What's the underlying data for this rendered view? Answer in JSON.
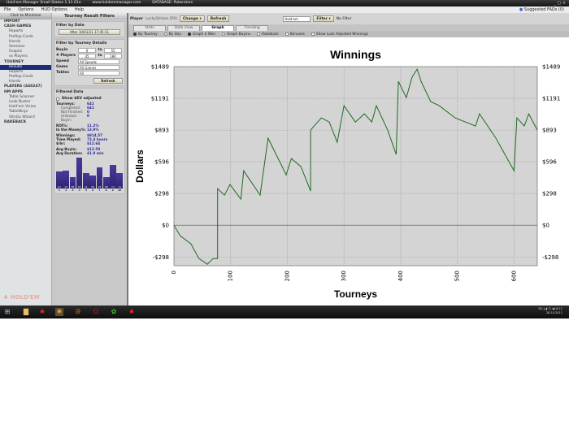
{
  "window": {
    "title": "Hold'em Manager Small Stakes 1.11.01e",
    "site": "www.holdemmanager.com",
    "database": "DATABASE: Pokerstars",
    "controls": [
      "_",
      "□",
      "×"
    ]
  },
  "menu": [
    "File",
    "Options",
    "HUD Options",
    "Help"
  ],
  "faq": "Suggested FAQs (0)",
  "nav": {
    "minimize": "Click to Minimize",
    "items": [
      {
        "label": "IMPORT",
        "type": "sec"
      },
      {
        "label": "CASH GAMES",
        "type": "sec"
      },
      {
        "label": "Reports"
      },
      {
        "label": "Preflop Cards"
      },
      {
        "label": "Hands"
      },
      {
        "label": "Sessions"
      },
      {
        "label": "Graphs"
      },
      {
        "label": "vs Players"
      },
      {
        "label": "TOURNEY",
        "type": "sec"
      },
      {
        "label": "Results",
        "type": "sel"
      },
      {
        "label": "Reports"
      },
      {
        "label": "Preflop Cards"
      },
      {
        "label": "Hands"
      },
      {
        "label": "PLAYERS (448247)",
        "type": "sec"
      },
      {
        "label": "HM APPS",
        "type": "sec"
      },
      {
        "label": "Table Scanner"
      },
      {
        "label": "Leak Buster"
      },
      {
        "label": "Hold'em Vision"
      },
      {
        "label": "TableNinja"
      },
      {
        "label": "SitnGo Wizard"
      },
      {
        "label": "RAKEBACK",
        "type": "sec"
      }
    ],
    "logo": "HOLD'EM MANAGER"
  },
  "filters": {
    "title": "Tourney Result Filters",
    "by_date": "Filter by Date",
    "date_btn": "After 10/01/11 17:45:11",
    "by_details": "Filter by Tourney Details",
    "buyin": {
      "label": "Buyin",
      "from": "0",
      "to_label": "to",
      "to": "55"
    },
    "players": {
      "label": "# Players",
      "from": "45",
      "to_label": "to",
      "to": "180"
    },
    "speed": {
      "label": "Speed",
      "value": "All Speeds"
    },
    "game": {
      "label": "Game",
      "value": "All Games"
    },
    "tables": {
      "label": "Tables",
      "value": "All"
    },
    "refresh": "Refresh",
    "filtered": "Filtered Data",
    "show_ev": "Show $EV adjusted",
    "stats": [
      [
        "Tourneys:",
        "641",
        ""
      ],
      [
        "Completed:",
        "641",
        "sub"
      ],
      [
        "Not Finished:",
        "0",
        "sub"
      ],
      [
        "Unknown Buyin:",
        "0",
        "sub"
      ],
      [
        "",
        "",
        ""
      ],
      [
        "ROI%:",
        "11.2%",
        ""
      ],
      [
        "In the Money%:",
        "13.9%",
        ""
      ],
      [
        "",
        "",
        ""
      ],
      [
        "Winnings:",
        "$914.57",
        ""
      ],
      [
        "Time Played:",
        "72.4 hours",
        ""
      ],
      [
        "$/hr:",
        "$12.64",
        ""
      ],
      [
        "",
        "",
        ""
      ],
      [
        "Avg Buyin:",
        "$12.50",
        ""
      ],
      [
        "Avg Duration:",
        "41.9 min",
        ""
      ]
    ],
    "finish_bars": {
      "labels": [
        "1",
        "2",
        "3",
        "4",
        "5",
        "6",
        "7",
        "8",
        "9",
        "10"
      ],
      "values": [
        "12",
        "13",
        "08",
        "22",
        "11",
        "09",
        "15",
        "08",
        "17",
        "11"
      ]
    }
  },
  "topbar": {
    "player_label": "Player",
    "player": "LuckyStrikes (PX)",
    "change": "Change",
    "refresh": "Refresh",
    "game": "Hold'em",
    "filter": "Filter",
    "no_filter": "No Filter"
  },
  "tabs": [
    {
      "label": "Stats"
    },
    {
      "label": "Data View"
    },
    {
      "label": "Graph",
      "active": true
    },
    {
      "label": "Trending"
    }
  ],
  "options": [
    {
      "label": "By Tourney",
      "kind": "radio",
      "on": true
    },
    {
      "label": "By Day",
      "kind": "radio",
      "on": false
    },
    {
      "label": "Graph $ Won",
      "kind": "radio",
      "on": true
    },
    {
      "label": "Graph Buyins",
      "kind": "radio",
      "on": false
    },
    {
      "label": "Rakeback",
      "kind": "check",
      "on": false
    },
    {
      "label": "Bonuses",
      "kind": "check",
      "on": false
    },
    {
      "label": "Show Luck Adjusted Winnings",
      "kind": "check",
      "on": true
    }
  ],
  "chart_data": {
    "type": "line",
    "title": "Winnings",
    "xlabel": "Tourneys",
    "ylabel": "Dollars",
    "xlim": [
      0,
      641
    ],
    "ylim": [
      -380,
      1489
    ],
    "yticks": [
      "$1489",
      "$1191",
      "$893",
      "$596",
      "$298",
      "$0",
      "-$298"
    ],
    "ytick_values": [
      1489,
      1191,
      893,
      596,
      298,
      0,
      -298
    ],
    "xticks": [
      "0",
      "100",
      "200",
      "300",
      "400",
      "500",
      "600"
    ],
    "grid": true,
    "color": "#1f6b1f",
    "background": "#d4d4d4",
    "x": [
      0,
      11,
      30,
      44,
      59,
      69,
      77,
      77,
      89,
      99,
      118,
      123,
      152,
      166,
      198,
      207,
      224,
      241,
      241,
      260,
      274,
      288,
      300,
      320,
      336,
      349,
      357,
      367,
      377,
      392,
      396,
      410,
      420,
      429,
      436,
      453,
      468,
      496,
      532,
      539,
      568,
      580,
      600,
      605,
      618,
      626,
      641
    ],
    "y": [
      0,
      -99,
      -175,
      -313,
      -366,
      -313,
      -313,
      343,
      282,
      382,
      244,
      511,
      282,
      817,
      473,
      626,
      550,
      321,
      893,
      1008,
      969,
      779,
      1122,
      969,
      1046,
      969,
      1122,
      1008,
      893,
      664,
      1351,
      1198,
      1389,
      1466,
      1351,
      1160,
      1122,
      1008,
      931,
      1046,
      817,
      702,
      511,
      1008,
      931,
      1046,
      893
    ]
  },
  "taskbar": {
    "lang": "RU",
    "time": "8:11",
    "date": "26.10.2011"
  }
}
